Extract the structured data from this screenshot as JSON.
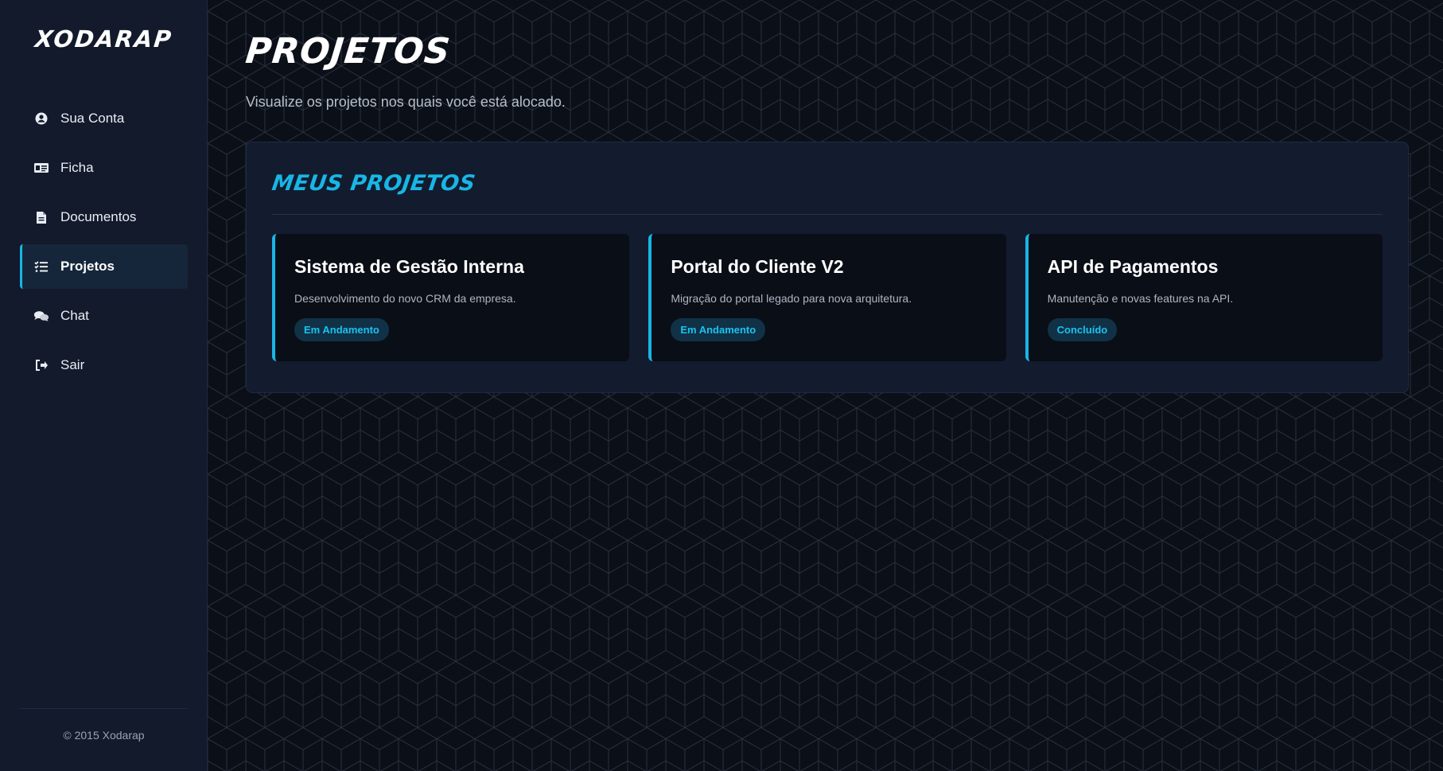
{
  "brand": {
    "logo": "XODARAP"
  },
  "sidebar": {
    "items": [
      {
        "label": "Sua Conta",
        "icon": "user-circle-icon"
      },
      {
        "label": "Ficha",
        "icon": "id-card-icon"
      },
      {
        "label": "Documentos",
        "icon": "file-icon"
      },
      {
        "label": "Projetos",
        "icon": "list-check-icon",
        "active": true
      },
      {
        "label": "Chat",
        "icon": "chat-bubbles-icon"
      },
      {
        "label": "Sair",
        "icon": "logout-icon"
      }
    ],
    "copyright": "© 2015 Xodarap"
  },
  "page": {
    "title": "PROJETOS",
    "subtitle": "Visualize os projetos nos quais você está alocado."
  },
  "panel": {
    "title": "MEUS PROJETOS",
    "projects": [
      {
        "title": "Sistema de Gestão Interna",
        "description": "Desenvolvimento do novo CRM da empresa.",
        "status": "Em Andamento"
      },
      {
        "title": "Portal do Cliente V2",
        "description": "Migração do portal legado para nova arquitetura.",
        "status": "Em Andamento"
      },
      {
        "title": "API de Pagamentos",
        "description": "Manutenção e novas features na API.",
        "status": "Concluído"
      }
    ]
  },
  "colors": {
    "accent": "#17b6e6",
    "sidebar_bg": "#121a2b",
    "panel_bg": "#131b2e",
    "card_bg": "#0a0e16",
    "page_bg": "#0b0f17"
  }
}
